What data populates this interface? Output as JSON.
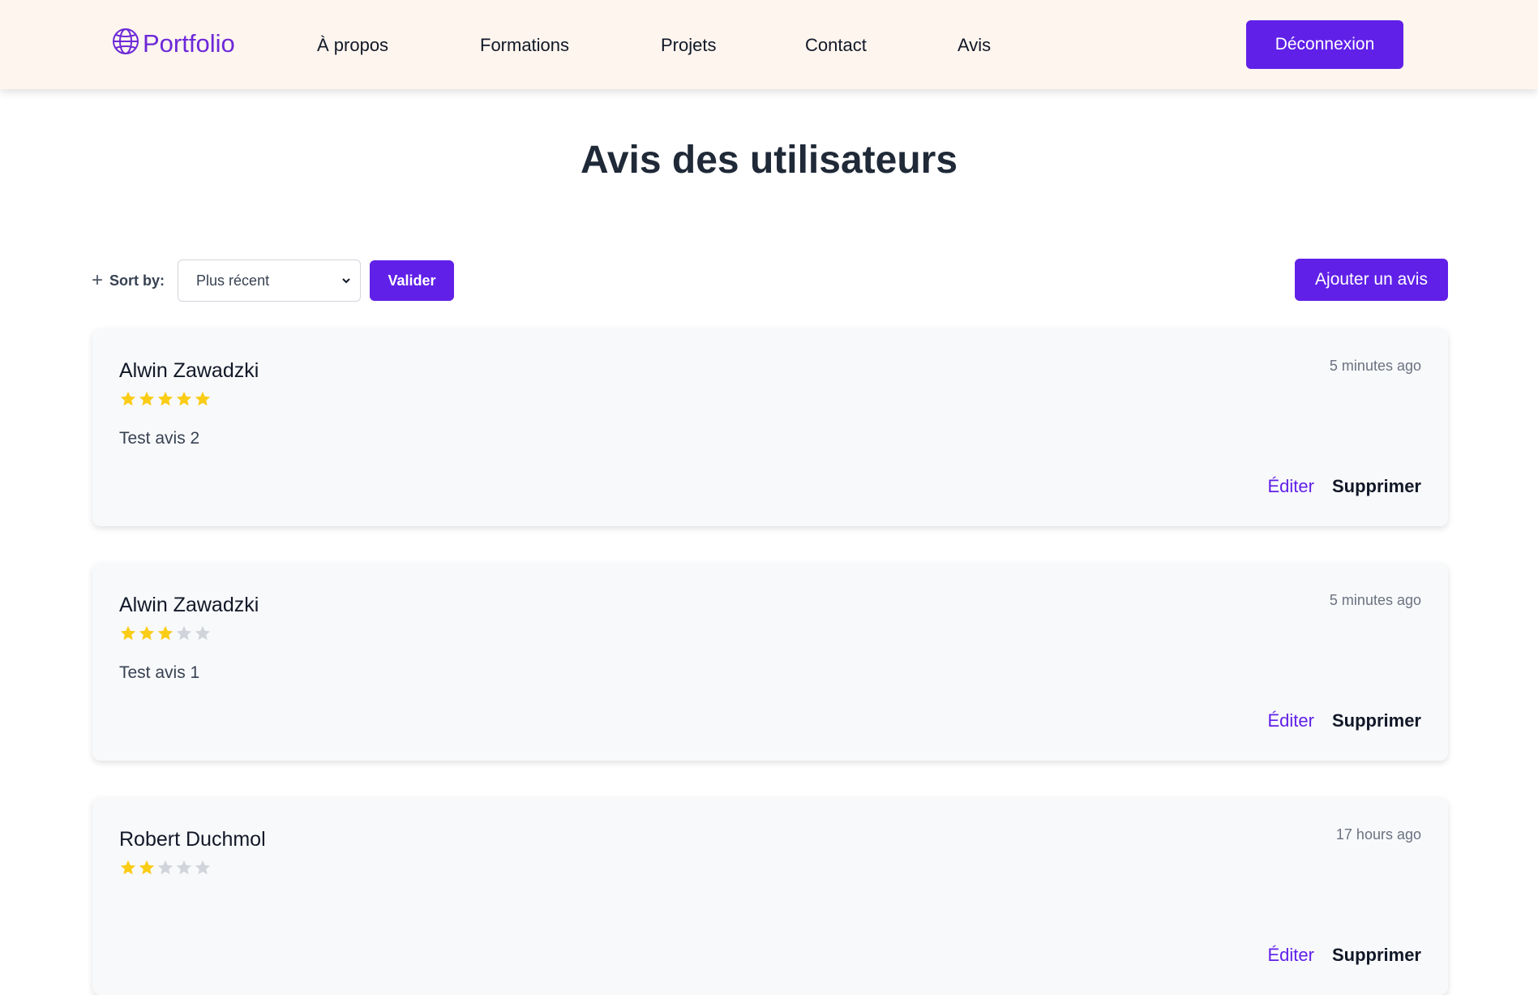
{
  "nav": {
    "brand": "Portfolio",
    "links": [
      "À propos",
      "Formations",
      "Projets",
      "Contact",
      "Avis"
    ],
    "logout_label": "Déconnexion"
  },
  "page": {
    "title": "Avis des utilisateurs"
  },
  "controls": {
    "sort_label": "Sort by:",
    "sort_value": "Plus récent",
    "validate_label": "Valider",
    "add_label": "Ajouter un avis"
  },
  "reviews": [
    {
      "author": "Alwin Zawadzki",
      "time": "5 minutes ago",
      "rating": 5,
      "text": "Test avis 2",
      "edit_label": "Éditer",
      "delete_label": "Supprimer"
    },
    {
      "author": "Alwin Zawadzki",
      "time": "5 minutes ago",
      "rating": 3,
      "text": "Test avis 1",
      "edit_label": "Éditer",
      "delete_label": "Supprimer"
    },
    {
      "author": "Robert Duchmol",
      "time": "17 hours ago",
      "rating": 2,
      "text": "",
      "edit_label": "Éditer",
      "delete_label": "Supprimer"
    }
  ],
  "colors": {
    "accent": "#6020e8",
    "star_filled": "#facc15",
    "star_empty": "#d1d5db",
    "navbar_bg": "#fdf5ee"
  },
  "icons": {
    "brand": "globe-icon",
    "sort": "plus-icon",
    "select": "chevron-down-icon",
    "rating": "star-icon"
  }
}
